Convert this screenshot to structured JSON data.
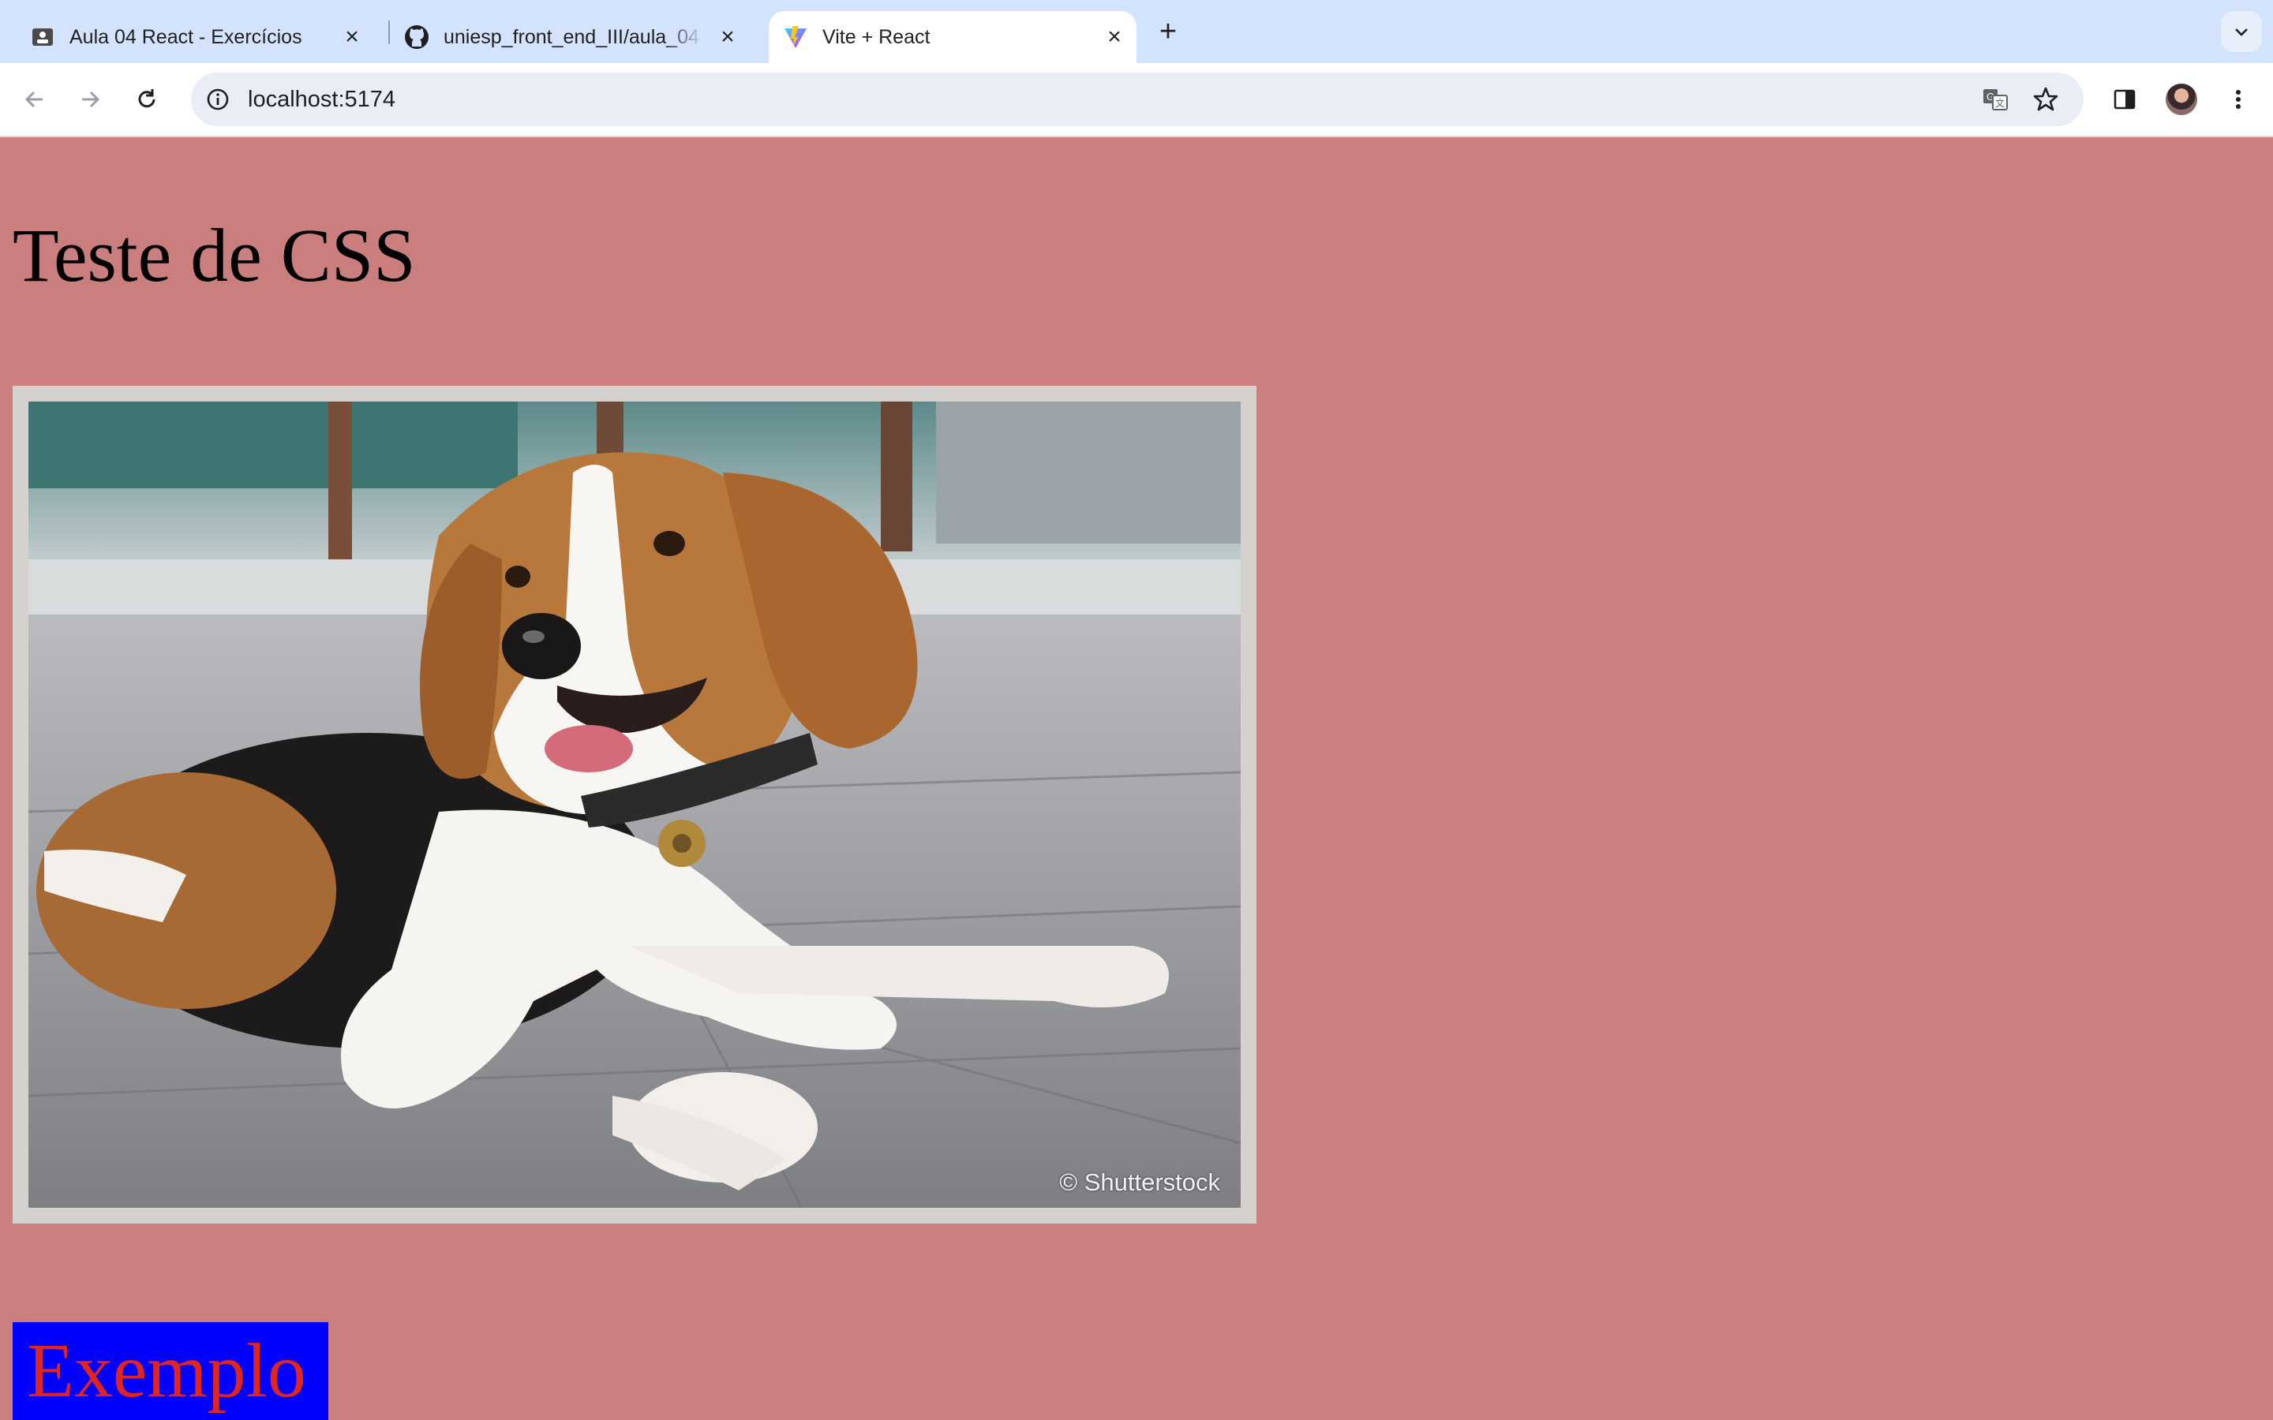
{
  "browser": {
    "tabs": [
      {
        "title": "Aula 04 React - Exercícios",
        "icon": "classroom-icon",
        "active": false
      },
      {
        "title": "uniesp_front_end_III/aula_04",
        "icon": "github-icon",
        "active": false
      },
      {
        "title": "Vite + React",
        "icon": "vite-icon",
        "active": true
      }
    ],
    "address": "localhost:5174"
  },
  "page": {
    "title": "Teste de CSS",
    "image": {
      "subject": "beagle dog lying on a tiled floor",
      "watermark": "© Shutterstock"
    },
    "example_text": "Exemplo"
  },
  "colors": {
    "page_background": "#cb7e7e",
    "frame_border": "#d4d1cf",
    "example_background": "#0000ff",
    "example_text": "#e0241e"
  }
}
